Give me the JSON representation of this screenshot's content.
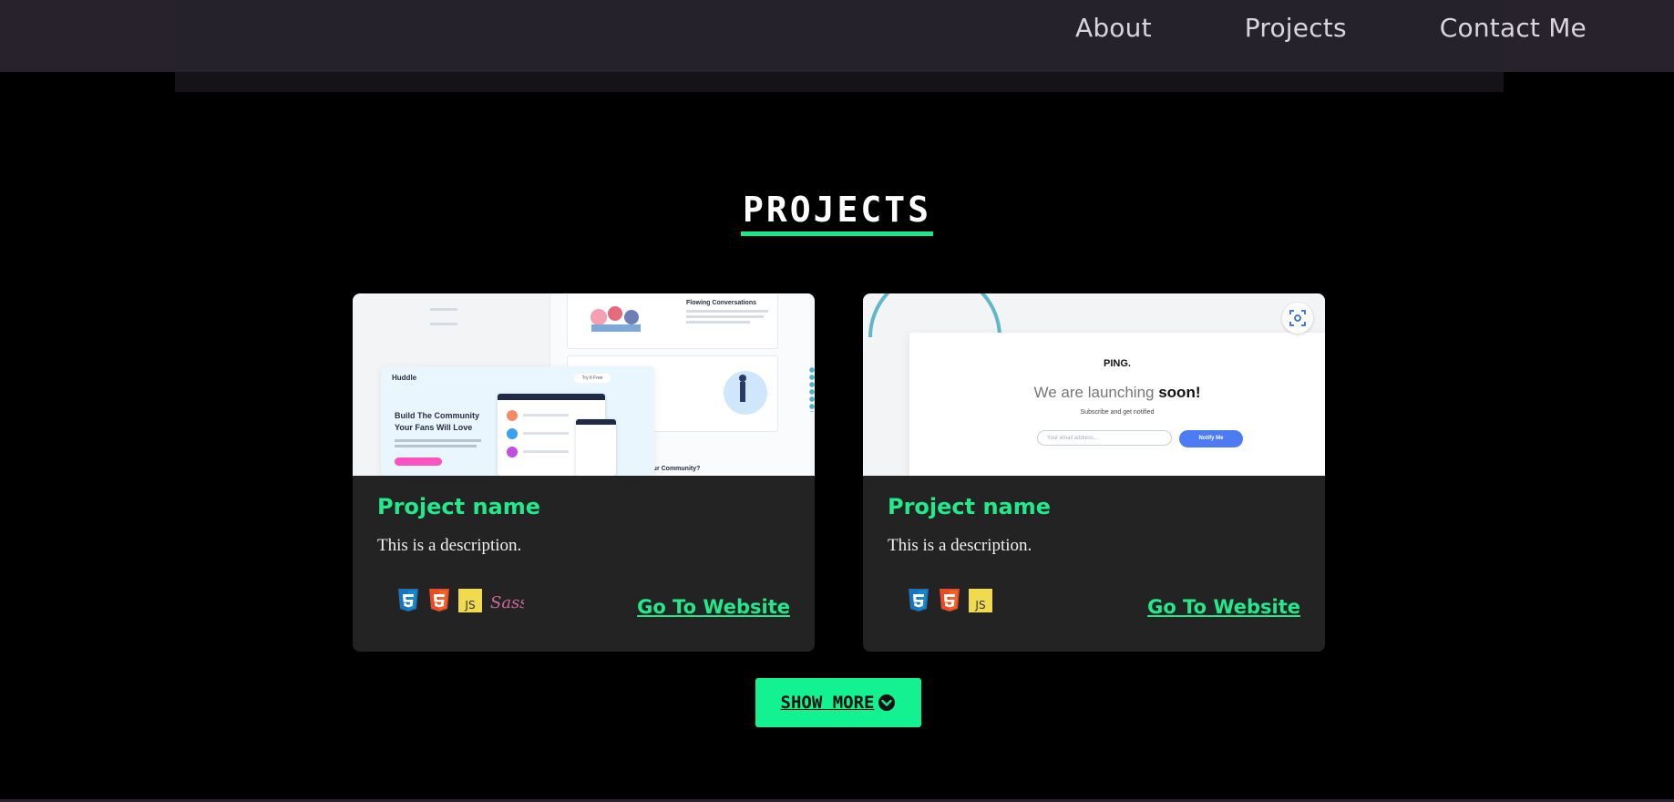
{
  "nav": {
    "items": [
      {
        "label": "About"
      },
      {
        "label": "Projects"
      },
      {
        "label": "Contact Me"
      }
    ]
  },
  "section": {
    "title": "PROJECTS"
  },
  "projects": [
    {
      "name": "Project name",
      "description": "This is a description.",
      "link_label": "Go To Website",
      "techs": [
        "css3-icon",
        "html5-icon",
        "javascript-icon",
        "sass-icon"
      ],
      "thumbnail": {
        "brand": "Huddle",
        "button_label": "Try It Free",
        "headline_line1": "Build The Community",
        "headline_line2": "Your Fans Will Love",
        "feature_title": "Flowing Conversations",
        "footer_text": "Ready To Build Your Community?"
      }
    },
    {
      "name": "Project name",
      "description": "This is a description.",
      "link_label": "Go To Website",
      "techs": [
        "css3-icon",
        "html5-icon",
        "javascript-icon"
      ],
      "thumbnail": {
        "brand": "PING.",
        "headline_light": "We are launching ",
        "headline_bold": "soon!",
        "subtext": "Subscribe and get notified",
        "input_placeholder": "Your email address...",
        "button_label": "Notify Me"
      }
    }
  ],
  "show_more": {
    "label": "SHOW MORE"
  },
  "colors": {
    "accent": "#17e98b",
    "card": "#232323",
    "topbar": "#27222c"
  }
}
